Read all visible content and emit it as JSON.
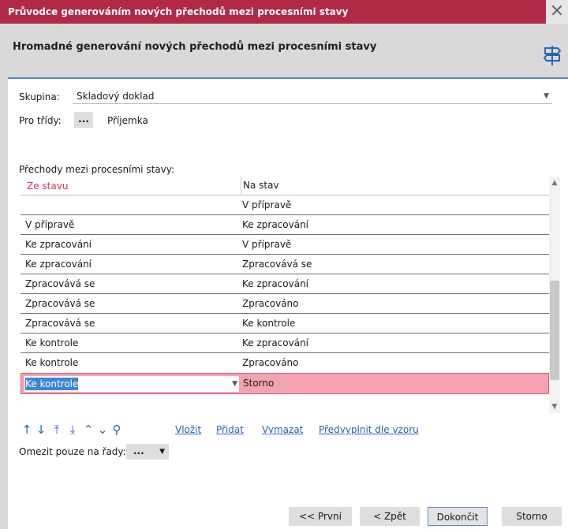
{
  "window": {
    "title": "Průvodce generováním nových přechodů mezi procesními stavy",
    "close_glyph": "✕"
  },
  "header": {
    "heading": "Hromadné generování nových přechodů mezi procesními stavy",
    "icon": "signpost-icon"
  },
  "form": {
    "group_label": "Skupina:",
    "group_value": "Skladový doklad",
    "classes_label": "Pro třídy:",
    "classes_button": "...",
    "classes_value": "Příjemka",
    "transitions_label": "Přechody mezi procesními stavy:"
  },
  "grid": {
    "columns": [
      "Ze stavu",
      "Na stav"
    ],
    "rows": [
      {
        "from": "",
        "to": "V přípravě"
      },
      {
        "from": "V přípravě",
        "to": "Ke zpracování"
      },
      {
        "from": "Ke zpracování",
        "to": "V přípravě"
      },
      {
        "from": "Ke zpracování",
        "to": "Zpracovává se"
      },
      {
        "from": "Zpracovává se",
        "to": "Ke zpracování"
      },
      {
        "from": "Zpracovává se",
        "to": "Zpracováno"
      },
      {
        "from": "Zpracovává se",
        "to": "Ke kontrole"
      },
      {
        "from": "Ke kontrole",
        "to": "Ke zpracování"
      },
      {
        "from": "Ke kontrole",
        "to": "Zpracováno"
      }
    ],
    "selected_row": {
      "from": "Ke kontrole",
      "to": "Storno"
    }
  },
  "toolbar": {
    "icons": [
      "move-up-icon",
      "move-down-icon",
      "move-top-icon",
      "move-bottom-icon",
      "collapse-icon",
      "expand-icon",
      "search-icon"
    ],
    "insert": "Vložit",
    "add": "Přidat",
    "delete": "Vymazat",
    "prefill": "Předvyplnit dle vzoru"
  },
  "restrict": {
    "label": "Omezit pouze na řady:",
    "button": "..."
  },
  "buttons": {
    "first": "<< První",
    "back": "< Zpět",
    "finish": "Dokončit",
    "cancel": "Storno"
  },
  "colors": {
    "titlebar": "#b02a48",
    "selected_row": "#f4a3b3",
    "link": "#2a63b8",
    "accent_border": "#5b86c9"
  }
}
